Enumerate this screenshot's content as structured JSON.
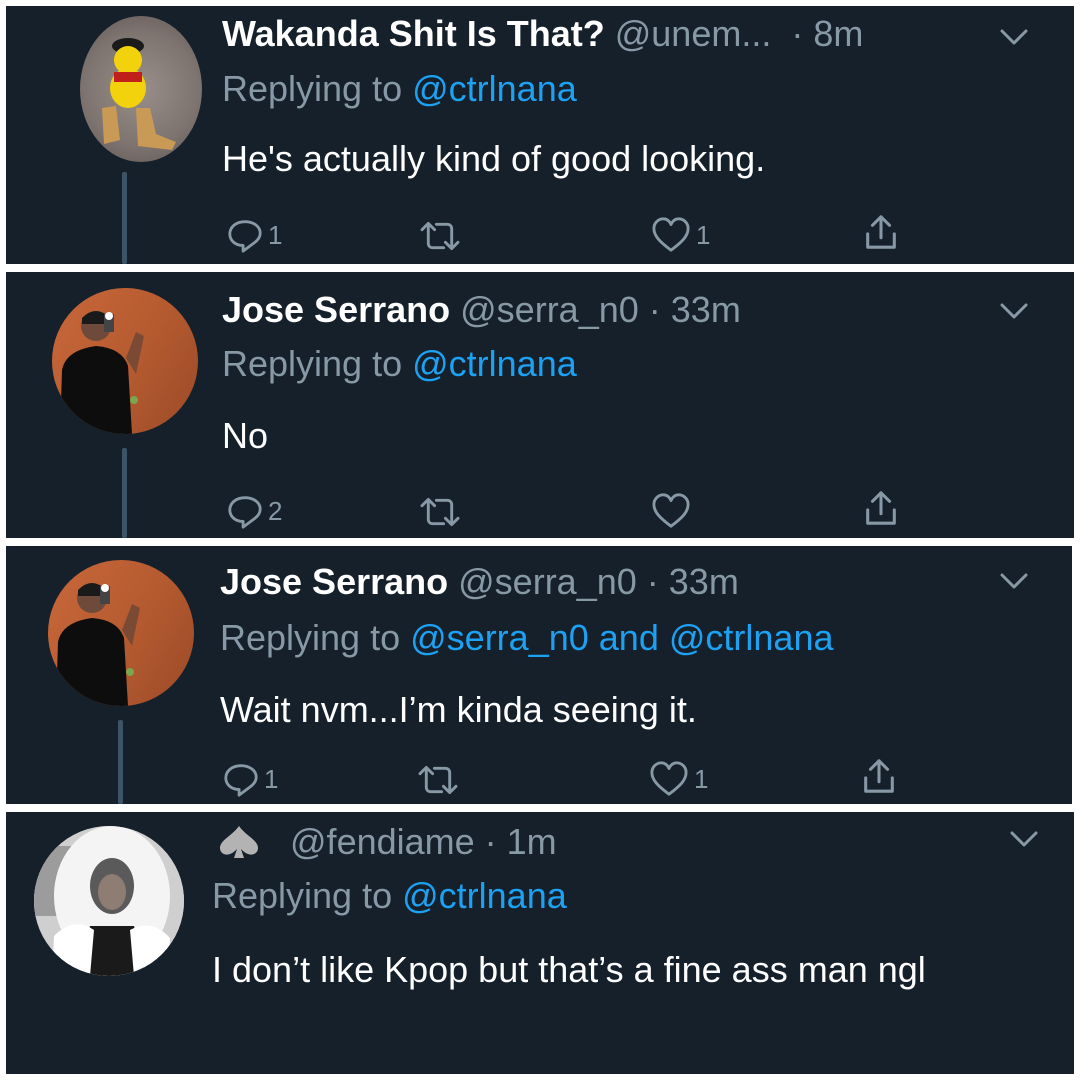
{
  "tweets": [
    {
      "display_name": "Wakanda Shit Is That?",
      "handle": "@unem...",
      "time": "· 8m",
      "replying_prefix": "Replying to",
      "mention1": "@ctrlnana",
      "mention_join": "",
      "mention2": "",
      "text": "He's actually kind of good looking.",
      "reply_count": "1",
      "retweet_count": "",
      "like_count": "1"
    },
    {
      "display_name": "Jose Serrano",
      "handle": "@serra_n0",
      "time": "· 33m",
      "replying_prefix": "Replying to",
      "mention1": "@ctrlnana",
      "mention_join": "",
      "mention2": "",
      "text": "No",
      "reply_count": "2",
      "retweet_count": "",
      "like_count": ""
    },
    {
      "display_name": "Jose Serrano",
      "handle": "@serra_n0",
      "time": "· 33m",
      "replying_prefix": "Replying to",
      "mention1": "@serra_n0",
      "mention_join": "and",
      "mention2": "@ctrlnana",
      "text": "Wait nvm...I’m kinda seeing it.",
      "reply_count": "1",
      "retweet_count": "",
      "like_count": "1"
    },
    {
      "display_name": "",
      "handle": "@fendiame",
      "time": "· 1m",
      "replying_prefix": "Replying to",
      "mention1": "@ctrlnana",
      "mention_join": "",
      "mention2": "",
      "text": "I don’t like Kpop but that’s a fine ass man ngl",
      "reply_count": "",
      "retweet_count": "",
      "like_count": ""
    }
  ],
  "icons": [
    "reply-icon",
    "retweet-icon",
    "like-icon",
    "share-icon",
    "chevron-down-icon",
    "spade-icon"
  ],
  "colors": {
    "background": "#15202b",
    "secondary_text": "#8899a6",
    "link": "#1da1f2",
    "primary_text": "#ffffff",
    "thread_line": "#3d5466"
  }
}
